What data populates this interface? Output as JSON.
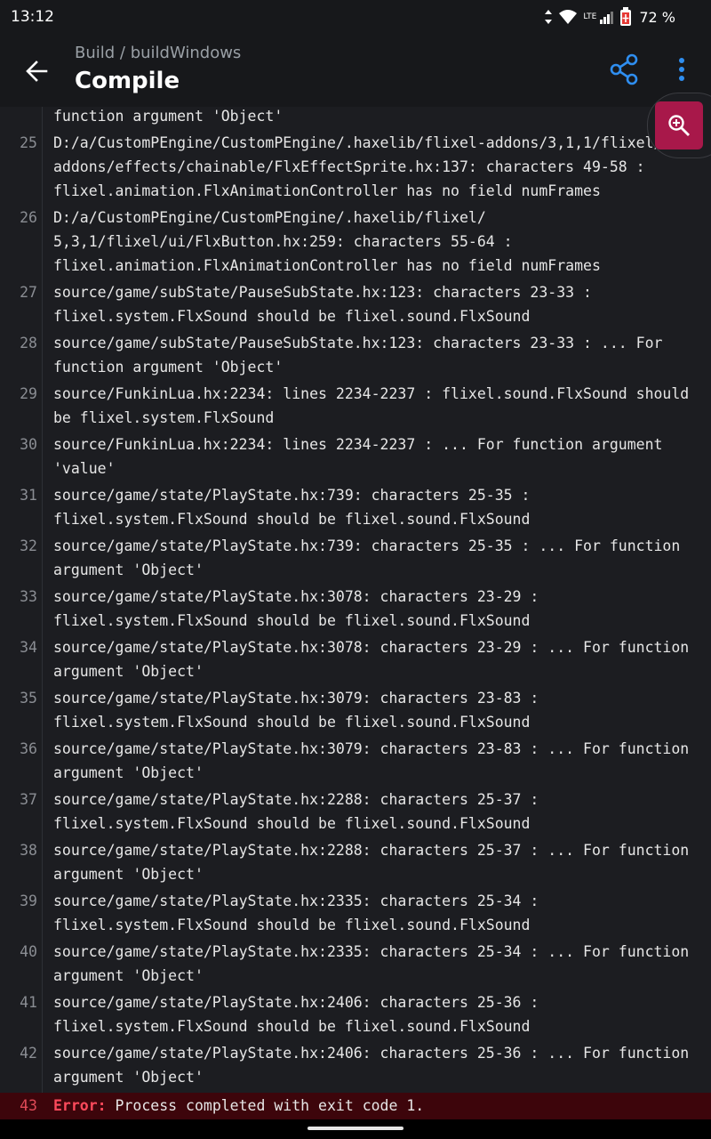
{
  "status_bar": {
    "time": "13:12",
    "network": "LTE",
    "battery": "72 %"
  },
  "app_bar": {
    "breadcrumb": "Build / buildWindows",
    "title": "Compile",
    "back_icon": "arrow-left-icon",
    "share_icon": "share-icon",
    "more_icon": "more-vertical-icon"
  },
  "zoom": {
    "icon": "zoom-in-icon"
  },
  "colors": {
    "accent": "#2f8ef0",
    "zoom_button": "#a8184a",
    "error_text": "#ff4a5c",
    "error_row": "#3d050b"
  },
  "log": {
    "lines": [
      {
        "num": "",
        "text": "function argument 'Object'"
      },
      {
        "num": "25",
        "text": "D:/a/CustomPEngine/CustomPEngine/.haxelib/flixel-addons/3,1,1/flixel/\naddons/effects/chainable/FlxEffectSprite.hx:137: characters 49-58 :\nflixel.animation.FlxAnimationController has no field numFrames"
      },
      {
        "num": "26",
        "text": "D:/a/CustomPEngine/CustomPEngine/.haxelib/flixel/\n5,3,1/flixel/ui/FlxButton.hx:259: characters 55-64 :\nflixel.animation.FlxAnimationController has no field numFrames"
      },
      {
        "num": "27",
        "text": "source/game/subState/PauseSubState.hx:123: characters 23-33 :\nflixel.system.FlxSound should be flixel.sound.FlxSound"
      },
      {
        "num": "28",
        "text": "source/game/subState/PauseSubState.hx:123: characters 23-33 : ... For\nfunction argument 'Object'"
      },
      {
        "num": "29",
        "text": "source/FunkinLua.hx:2234: lines 2234-2237 : flixel.sound.FlxSound should\nbe flixel.system.FlxSound"
      },
      {
        "num": "30",
        "text": "source/FunkinLua.hx:2234: lines 2234-2237 : ... For function argument\n'value'"
      },
      {
        "num": "31",
        "text": "source/game/state/PlayState.hx:739: characters 25-35 :\nflixel.system.FlxSound should be flixel.sound.FlxSound"
      },
      {
        "num": "32",
        "text": "source/game/state/PlayState.hx:739: characters 25-35 : ... For function\nargument 'Object'"
      },
      {
        "num": "33",
        "text": "source/game/state/PlayState.hx:3078: characters 23-29 :\nflixel.system.FlxSound should be flixel.sound.FlxSound"
      },
      {
        "num": "34",
        "text": "source/game/state/PlayState.hx:3078: characters 23-29 : ... For function\nargument 'Object'"
      },
      {
        "num": "35",
        "text": "source/game/state/PlayState.hx:3079: characters 23-83 :\nflixel.system.FlxSound should be flixel.sound.FlxSound"
      },
      {
        "num": "36",
        "text": "source/game/state/PlayState.hx:3079: characters 23-83 : ... For function\nargument 'Object'"
      },
      {
        "num": "37",
        "text": "source/game/state/PlayState.hx:2288: characters 25-37 :\nflixel.system.FlxSound should be flixel.sound.FlxSound"
      },
      {
        "num": "38",
        "text": "source/game/state/PlayState.hx:2288: characters 25-37 : ... For function\nargument 'Object'"
      },
      {
        "num": "39",
        "text": "source/game/state/PlayState.hx:2335: characters 25-34 :\nflixel.system.FlxSound should be flixel.sound.FlxSound"
      },
      {
        "num": "40",
        "text": "source/game/state/PlayState.hx:2335: characters 25-34 : ... For function\nargument 'Object'"
      },
      {
        "num": "41",
        "text": "source/game/state/PlayState.hx:2406: characters 25-36 :\nflixel.system.FlxSound should be flixel.sound.FlxSound"
      },
      {
        "num": "42",
        "text": "source/game/state/PlayState.hx:2406: characters 25-36 : ... For function\nargument 'Object'"
      }
    ],
    "error_line": {
      "num": "43",
      "label": "Error:",
      "text": " Process completed with exit code 1."
    }
  }
}
